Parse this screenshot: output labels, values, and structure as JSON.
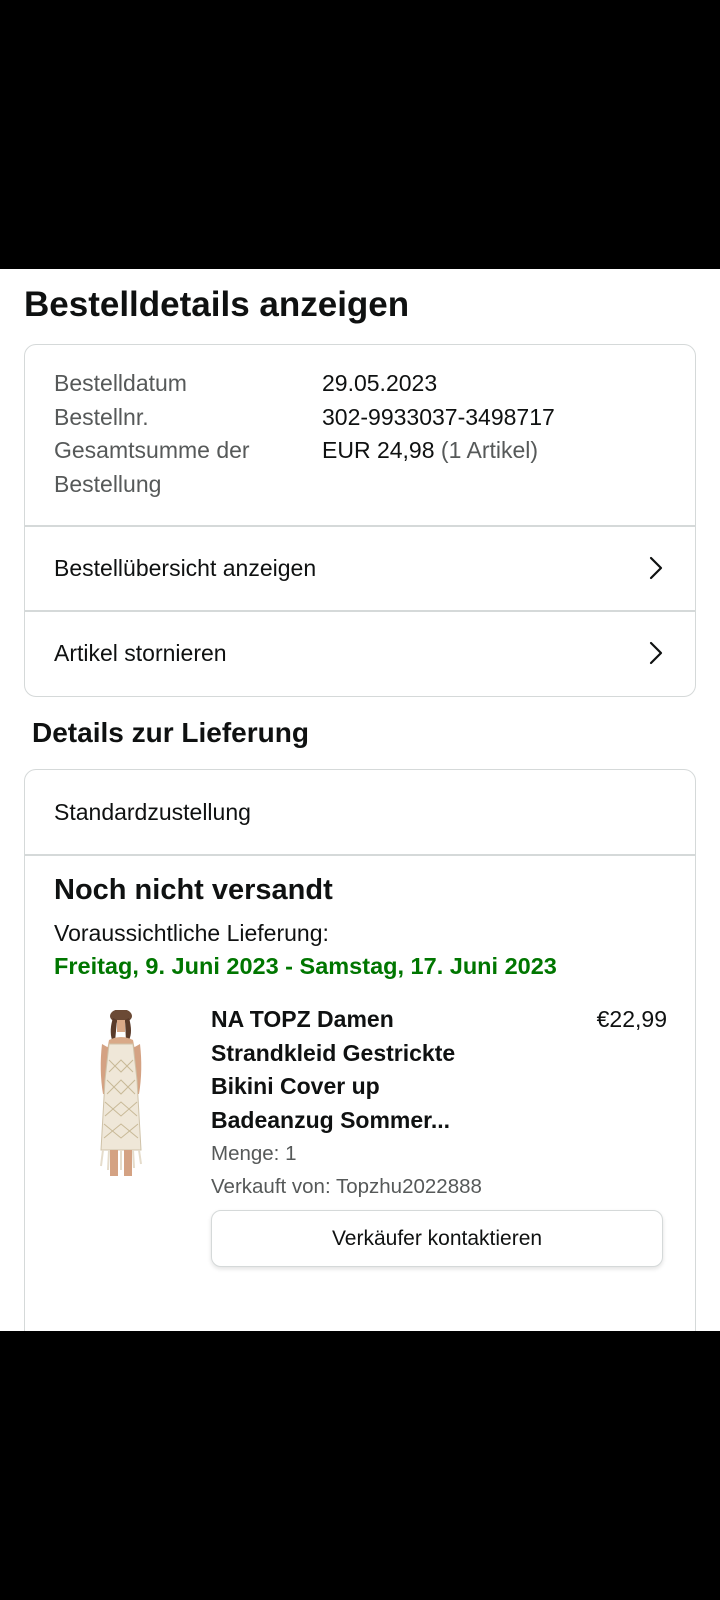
{
  "page": {
    "title": "Bestelldetails anzeigen"
  },
  "order_summary": {
    "rows": [
      {
        "label": "Bestelldatum",
        "value": "29.05.2023"
      },
      {
        "label": "Bestellnr.",
        "value": "302-9933037-3498717"
      },
      {
        "label": "Gesamtsumme der Bestellung",
        "value": "EUR 24,98",
        "value_note": "(1 Artikel)"
      }
    ],
    "links": [
      {
        "label": "Bestellübersicht anzeigen",
        "icon": "chevron-right-icon"
      },
      {
        "label": "Artikel stornieren",
        "icon": "chevron-right-icon"
      }
    ]
  },
  "delivery": {
    "section_title": "Details zur Lieferung",
    "shipping_method": "Standardzustellung",
    "status": "Noch nicht versandt",
    "eta_label": "Voraussichtliche Lieferung:",
    "eta_range": "Freitag, 9. Juni 2023 - Samstag, 17. Juni 2023",
    "eta_color": "#007600",
    "item": {
      "title": "NA TOPZ Damen Strandkleid Gestrickte Bikini Cover up Badeanzug Sommer...",
      "price": "€22,99",
      "quantity": "Menge: 1",
      "seller": "Verkauft von: Topzhu2022888",
      "contact_button": "Verkäufer kontaktieren",
      "image_icon": "crochet-dress-image"
    }
  },
  "colors": {
    "background": "#ffffff",
    "text": "#0f1111",
    "secondary_text": "#565959",
    "border": "#d5d9d9",
    "system_bars": "#000000"
  }
}
